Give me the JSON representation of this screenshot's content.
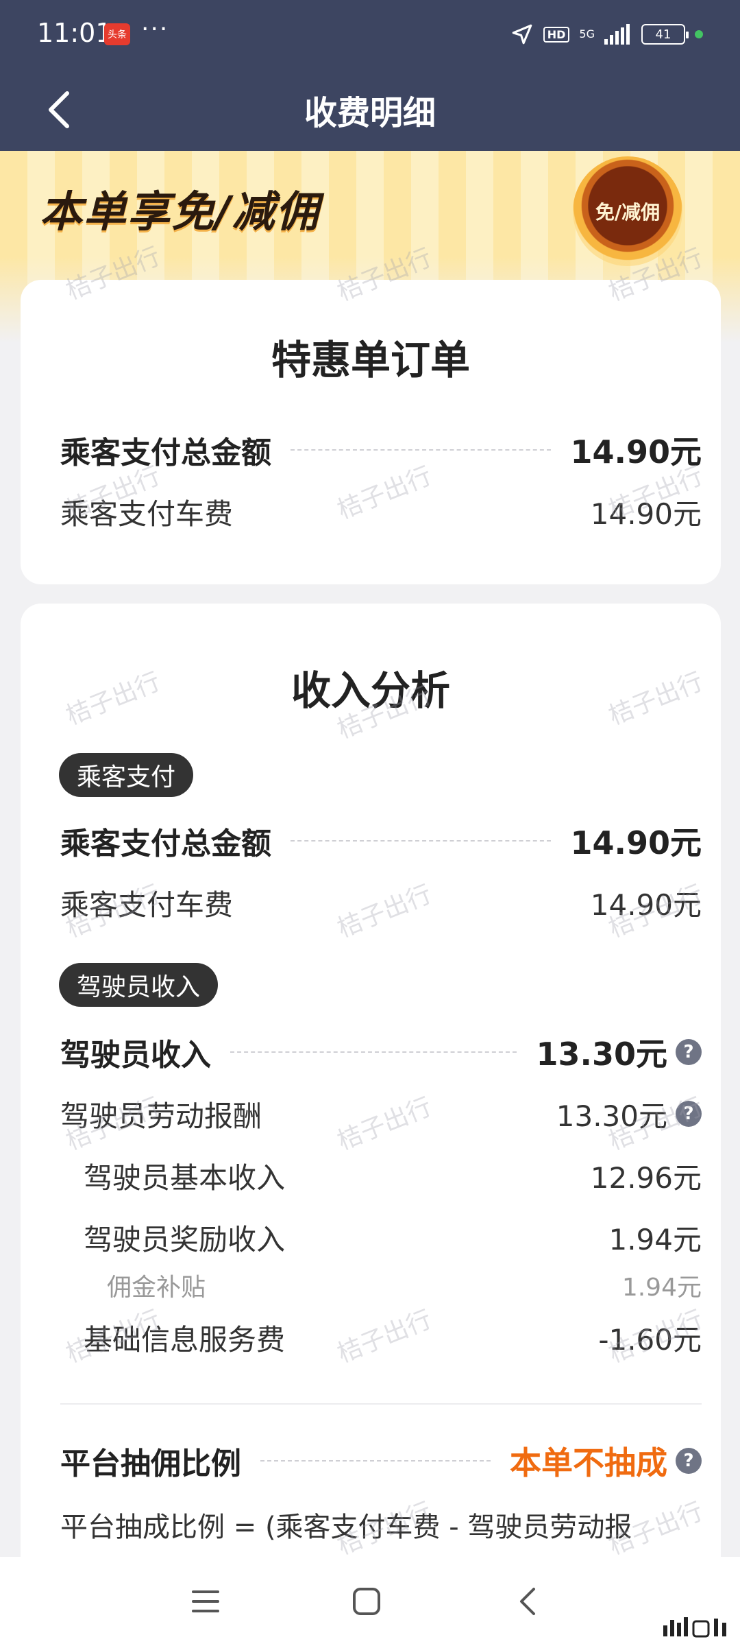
{
  "status_bar": {
    "time": "11:01",
    "app_badge": "头条",
    "more": "···",
    "hd": "HD",
    "network": "5G",
    "battery": "41"
  },
  "header": {
    "title": "收费明细"
  },
  "banner": {
    "promo": "本单享免/减佣",
    "medal": "免/减佣"
  },
  "order_card": {
    "title": "特惠单订单",
    "total_label": "乘客支付总金额",
    "total_value": "14.90元",
    "fare_label": "乘客支付车费",
    "fare_value": "14.90元"
  },
  "income_card": {
    "title": "收入分析",
    "passenger_tag": "乘客支付",
    "passenger_total_label": "乘客支付总金额",
    "passenger_total_value": "14.90元",
    "passenger_fare_label": "乘客支付车费",
    "passenger_fare_value": "14.90元",
    "driver_tag": "驾驶员收入",
    "driver_income_label": "驾驶员收入",
    "driver_income_value": "13.30元",
    "labor_label": "驾驶员劳动报酬",
    "labor_value": "13.30元",
    "basic_label": "驾驶员基本收入",
    "basic_value": "12.96元",
    "reward_label": "驾驶员奖励收入",
    "reward_value": "1.94元",
    "subsidy_label": "佣金补贴",
    "subsidy_value": "1.94元",
    "service_fee_label": "基础信息服务费",
    "service_fee_value": "-1.60元",
    "commission_label": "平台抽佣比例",
    "commission_value": "本单不抽成",
    "formula": "平台抽成比例 = (乘客支付车费 - 驾驶员劳动报"
  },
  "watermark": "桔子出行",
  "colors": {
    "header_bg": "#3d4561",
    "accent_orange": "#f06b10",
    "banner_yellow": "#fde7a5"
  }
}
